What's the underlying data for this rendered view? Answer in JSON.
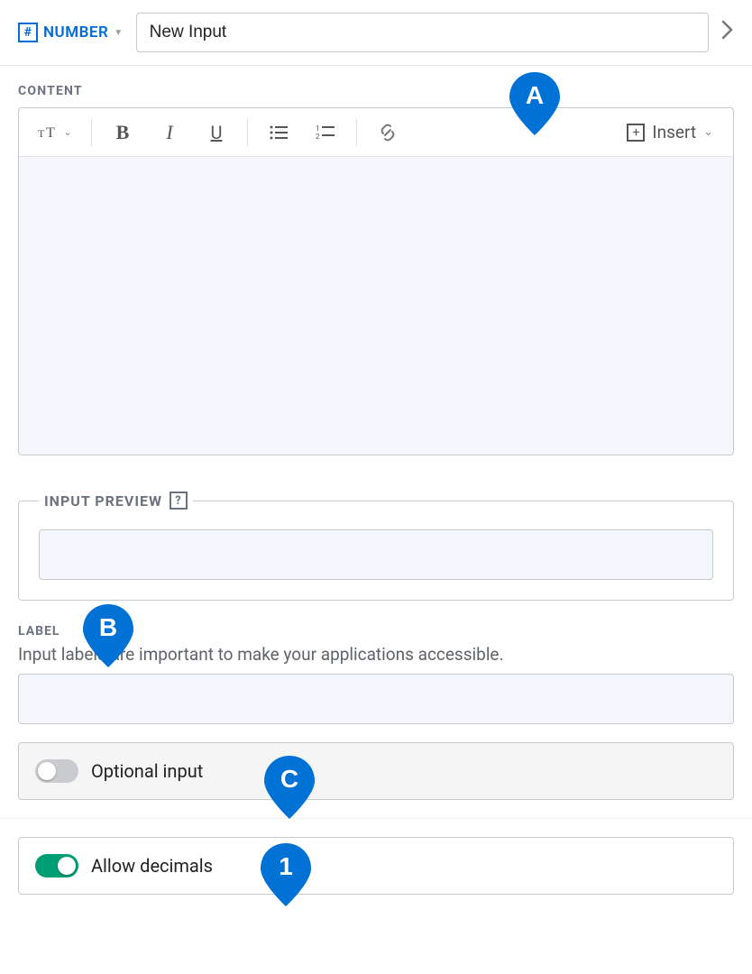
{
  "header": {
    "type_label": "NUMBER",
    "type_symbol": "#",
    "name_value": "New Input"
  },
  "content": {
    "section_label": "CONTENT",
    "insert_label": "Insert",
    "toolbar": {
      "text_style": "Text style",
      "bold": "B",
      "italic": "I",
      "underline": "U",
      "ul": "Bulleted list",
      "ol": "Numbered list",
      "link": "Link"
    }
  },
  "preview": {
    "legend": "INPUT PREVIEW",
    "help": "?"
  },
  "label": {
    "heading": "LABEL",
    "description": "Input labels are important to make your applications accessible."
  },
  "toggles": {
    "optional": {
      "label": "Optional input",
      "on": false
    },
    "decimals": {
      "label": "Allow decimals",
      "on": true
    }
  },
  "markers": {
    "a": "A",
    "b": "B",
    "c": "C",
    "one": "1"
  }
}
